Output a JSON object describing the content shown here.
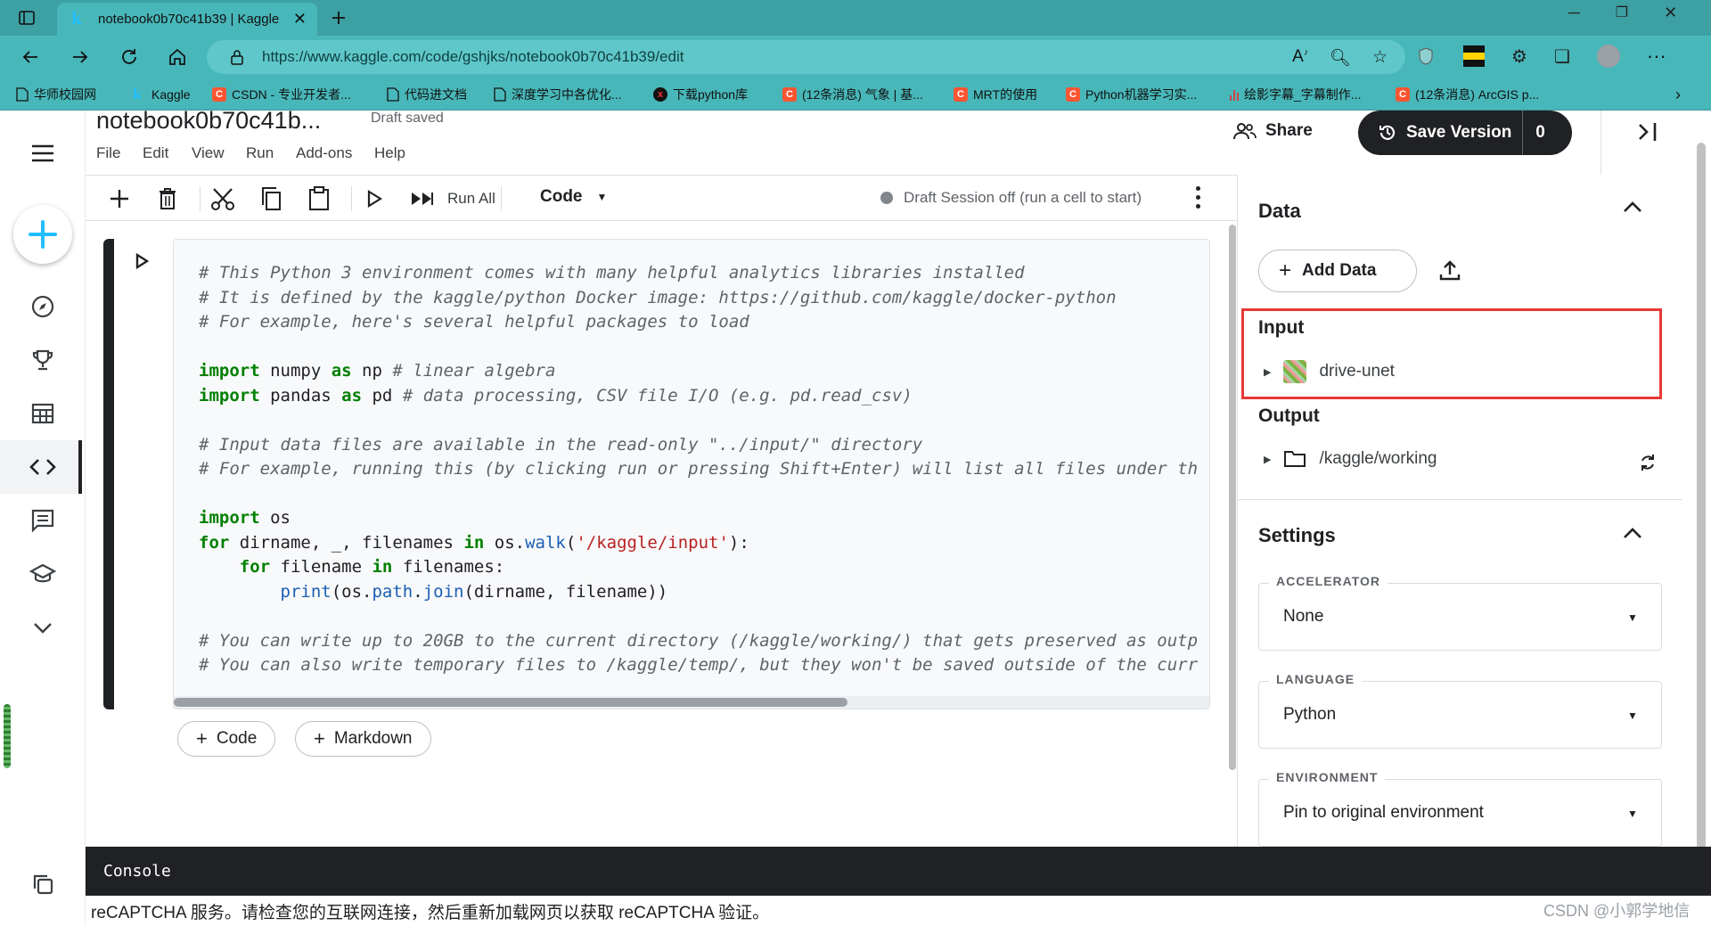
{
  "browser": {
    "tab_title": "notebook0b70c41b39 | Kaggle",
    "tab_icon": "k",
    "url": "https://www.kaggle.com/code/gshjks/notebook0b70c41b39/edit",
    "bookmarks": [
      {
        "label": "华师校园网",
        "icon": "page-icon"
      },
      {
        "label": "Kaggle",
        "icon": "kaggle-icon"
      },
      {
        "label": "CSDN - 专业开发者...",
        "icon": "csdn-icon"
      },
      {
        "label": "代码进文档",
        "icon": "page-icon"
      },
      {
        "label": "深度学习中各优化...",
        "icon": "page-icon"
      },
      {
        "label": "下载python库",
        "icon": "x-icon"
      },
      {
        "label": "(12条消息) 气象 | 基...",
        "icon": "csdn-icon"
      },
      {
        "label": "MRT的使用",
        "icon": "csdn-icon"
      },
      {
        "label": "Python机器学习实...",
        "icon": "csdn-icon"
      },
      {
        "label": "绘影字幕_字幕制作...",
        "icon": "bars-icon"
      },
      {
        "label": "(12条消息) ArcGIS p...",
        "icon": "csdn-icon"
      }
    ]
  },
  "notebook": {
    "title": "notebook0b70c41b...",
    "status": "Draft saved",
    "menu": [
      "File",
      "Edit",
      "View",
      "Run",
      "Add-ons",
      "Help"
    ],
    "share_label": "Share",
    "save_version_label": "Save Version",
    "save_version_count": "0"
  },
  "toolbar": {
    "run_all_label": "Run All",
    "cell_type": "Code",
    "session_status": "Draft Session off (run a cell to start)"
  },
  "cell": {
    "lines": [
      [
        {
          "t": "# This Python 3 environment comes with many helpful analytics libraries installed",
          "c": "cm"
        }
      ],
      [
        {
          "t": "# It is defined by the kaggle/python Docker image: https://github.com/kaggle/docker-python",
          "c": "cm"
        }
      ],
      [
        {
          "t": "# For example, here's several helpful packages to load",
          "c": "cm"
        }
      ],
      [],
      [
        {
          "t": "import",
          "c": "kw"
        },
        {
          "t": " numpy "
        },
        {
          "t": "as",
          "c": "kw"
        },
        {
          "t": " np "
        },
        {
          "t": "# linear algebra",
          "c": "cm"
        }
      ],
      [
        {
          "t": "import",
          "c": "kw"
        },
        {
          "t": " pandas "
        },
        {
          "t": "as",
          "c": "kw"
        },
        {
          "t": " pd "
        },
        {
          "t": "# data processing, CSV file I/O (e.g. pd.read_csv)",
          "c": "cm"
        }
      ],
      [],
      [
        {
          "t": "# Input data files are available in the read-only \"../input/\" directory",
          "c": "cm"
        }
      ],
      [
        {
          "t": "# For example, running this (by clicking run or pressing Shift+Enter) will list all files under th",
          "c": "cm"
        }
      ],
      [],
      [
        {
          "t": "import",
          "c": "kw"
        },
        {
          "t": " os"
        }
      ],
      [
        {
          "t": "for",
          "c": "kw"
        },
        {
          "t": " dirname, _, filenames "
        },
        {
          "t": "in",
          "c": "kw"
        },
        {
          "t": " os."
        },
        {
          "t": "walk",
          "c": "fn"
        },
        {
          "t": "("
        },
        {
          "t": "'/kaggle/input'",
          "c": "str"
        },
        {
          "t": "):"
        }
      ],
      [
        {
          "t": "    "
        },
        {
          "t": "for",
          "c": "kw"
        },
        {
          "t": " filename "
        },
        {
          "t": "in",
          "c": "kw"
        },
        {
          "t": " filenames:"
        }
      ],
      [
        {
          "t": "        "
        },
        {
          "t": "print",
          "c": "fn"
        },
        {
          "t": "(os."
        },
        {
          "t": "path",
          "c": "fn"
        },
        {
          "t": "."
        },
        {
          "t": "join",
          "c": "fn"
        },
        {
          "t": "(dirname, filename))"
        }
      ],
      [],
      [
        {
          "t": "# You can write up to 20GB to the current directory (/kaggle/working/) that gets preserved as outp",
          "c": "cm"
        }
      ],
      [
        {
          "t": "# You can also write temporary files to /kaggle/temp/, but they won't be saved outside of the curr",
          "c": "cm"
        }
      ]
    ]
  },
  "add_cell": {
    "code_label": "Code",
    "markdown_label": "Markdown"
  },
  "panel": {
    "data_title": "Data",
    "add_data_label": "Add Data",
    "input_title": "Input",
    "input_item": "drive-unet",
    "output_title": "Output",
    "output_item": "/kaggle/working",
    "settings_title": "Settings",
    "accelerator_label": "ACCELERATOR",
    "accelerator_value": "None",
    "language_label": "LANGUAGE",
    "language_value": "Python",
    "environment_label": "ENVIRONMENT",
    "environment_value": "Pin to original environment",
    "highlight_color": "#e53935"
  },
  "console": {
    "label": "Console"
  },
  "notice": {
    "text": "reCAPTCHA 服务。请检查您的互联网连接，然后重新加载网页以获取 reCAPTCHA 验证。"
  },
  "watermark": "CSDN @小郭学地信"
}
